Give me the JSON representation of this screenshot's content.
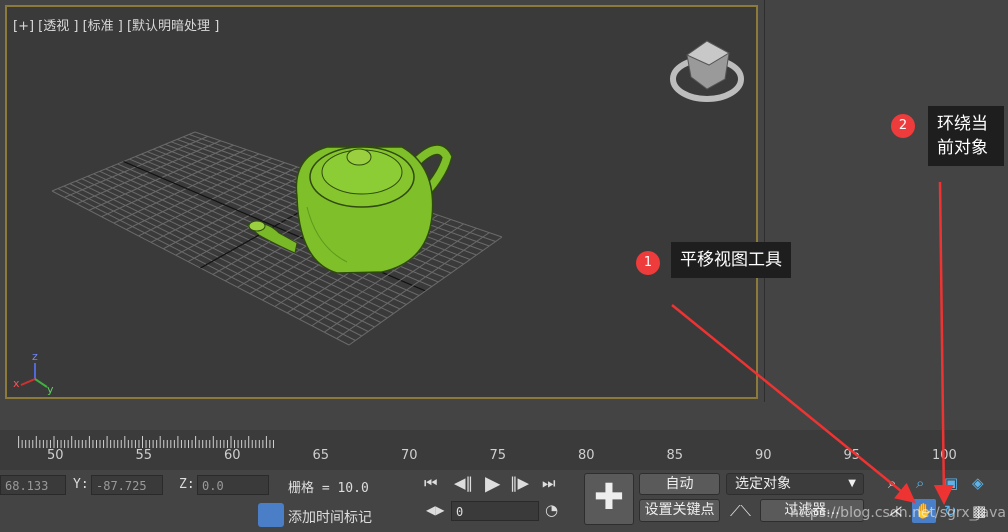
{
  "viewport": {
    "label": "[+] [透视 ] [标准 ] [默认明暗处理 ]",
    "axis_labels": {
      "z": "z",
      "x": "x",
      "y": "y"
    }
  },
  "timeline": {
    "ticks": [
      "50",
      "55",
      "60",
      "65",
      "70",
      "75",
      "80",
      "85",
      "90",
      "95",
      "100"
    ]
  },
  "status": {
    "x_value": "68.133",
    "y_label": "Y:",
    "y_value": "-87.725",
    "z_label": "Z:",
    "z_value": "0.0",
    "grid_text": "栅格 = 10.0",
    "add_time_tag": "添加时间标记"
  },
  "playback": {
    "frame_value": "0"
  },
  "keying": {
    "auto_label": "自动",
    "set_key_label": "设置关键点",
    "selection_value": "选定对象",
    "filter_label": "过滤器..."
  },
  "annotations": {
    "callout1": {
      "badge": "1",
      "text": "平移视图工具"
    },
    "callout2": {
      "badge": "2",
      "text_line1": "环绕当",
      "text_line2": "前对象"
    }
  },
  "watermark": "https://blog.csdn.net/sgrx_java",
  "colors": {
    "accent_border": "#8c7a3a",
    "teapot": "#7fbf2a",
    "callout_bg": "#1e1e1e",
    "badge": "#ee3b3b",
    "arrow": "#ee3333"
  }
}
